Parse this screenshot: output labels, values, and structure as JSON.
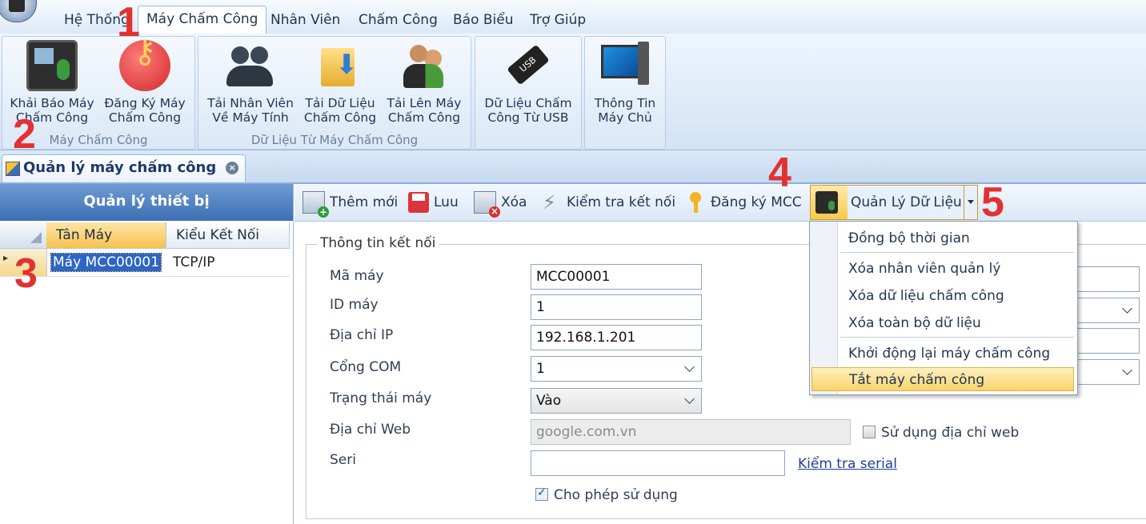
{
  "ribbon": {
    "tabs": [
      {
        "label": "Hệ Thống"
      },
      {
        "label": "Máy Chấm Công"
      },
      {
        "label": "Nhân Viên"
      },
      {
        "label": "Chấm Công"
      },
      {
        "label": "Báo Biểu"
      },
      {
        "label": "Trợ Giúp"
      }
    ],
    "active_tab": "Máy Chấm Công",
    "groups": [
      {
        "label": "Máy Chấm Công",
        "buttons": [
          {
            "label": "Khải Báo Máy\nChấm Công",
            "icon": "fingerprint-device-icon"
          },
          {
            "label": "Đăng Ký Máy\nChấm Công",
            "icon": "key-icon"
          }
        ]
      },
      {
        "label": "Dữ Liệu Từ Máy Chấm Công",
        "buttons": [
          {
            "label": "Tải Nhân Viên\nVề Máy Tính",
            "icon": "users-download-icon"
          },
          {
            "label": "Tải Dữ Liệu\nChấm Công",
            "icon": "folder-download-icon"
          },
          {
            "label": "Tải Lên Máy\nChấm Công",
            "icon": "people-upload-icon"
          }
        ]
      },
      {
        "label": "",
        "buttons": [
          {
            "label": "Dữ Liệu Chấm\nCông Từ USB",
            "icon": "usb-icon"
          }
        ]
      },
      {
        "label": "",
        "buttons": [
          {
            "label": "Thông Tin\nMáy Chủ",
            "icon": "computer-icon"
          }
        ]
      }
    ]
  },
  "steps": [
    "1",
    "2",
    "3",
    "4",
    "5"
  ],
  "doc_tab": {
    "label": "Quản lý máy chấm công"
  },
  "left_panel": {
    "title": "Quản lý thiết bị",
    "columns": [
      "Tân Máy",
      "Kiểu Kết Nối"
    ],
    "rows": [
      {
        "name": "Máy MCC00001",
        "connection": "TCP/IP"
      }
    ]
  },
  "toolbar": {
    "add": "Thêm mới",
    "save": "Luu",
    "delete": "Xóa",
    "test_connection": "Kiểm tra kết nối",
    "register": "Đăng ký MCC",
    "data_manage": "Quản Lý Dữ Liệu"
  },
  "form": {
    "legend": "Thông tin kết nối",
    "labels": {
      "code": "Mã máy",
      "id": "ID máy",
      "ip": "Địa chỉ IP",
      "com": "Cổng COM",
      "status": "Trạng thái máy",
      "web": "Địa chỉ Web",
      "serial": "Seri"
    },
    "values": {
      "code": "MCC00001",
      "id": "1",
      "ip": "192.168.1.201",
      "com": "1",
      "status": "Vào",
      "web": "google.com.vn",
      "serial": ""
    },
    "use_web_label": "Sử dụng địa chỉ web",
    "use_web_checked": false,
    "check_serial_link": "Kiểm tra serial",
    "allow_use_label": "Cho phép sử dụng",
    "allow_use_checked": true
  },
  "menu": {
    "items": [
      "Đồng bộ thời gian",
      "Xóa nhân viên quản lý",
      "Xóa dữ liệu chấm công",
      "Xóa toàn bộ dữ liệu",
      "Khởi động lại máy chấm công",
      "Tắt máy chấm công"
    ],
    "highlighted": "Tắt máy chấm công"
  },
  "colors": {
    "step_red": "#e23131",
    "highlight": "#f7d36a",
    "accent_blue": "#3c6fb4"
  }
}
